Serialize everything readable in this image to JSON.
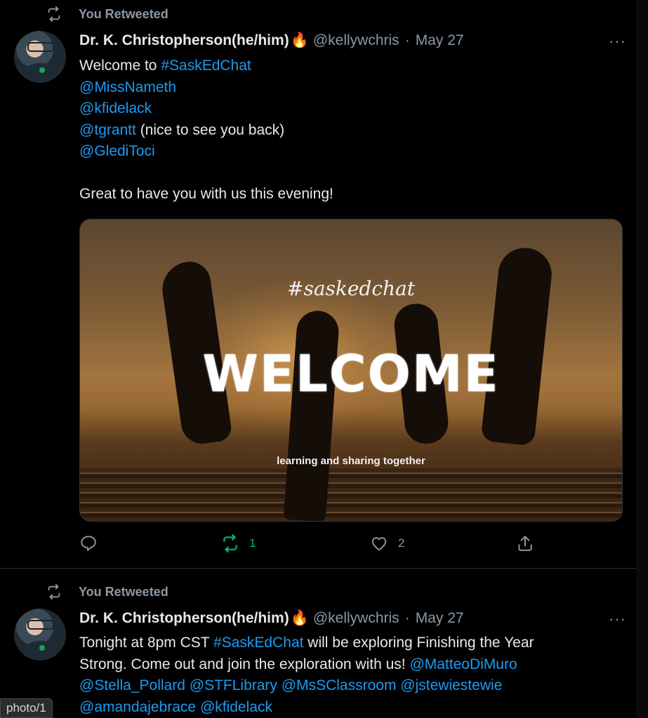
{
  "tweets": [
    {
      "retweet_label": "You Retweeted",
      "name": "Dr. K. Christopherson(he/him)",
      "emoji": "🔥",
      "handle": "@kellywchris",
      "sep": "·",
      "date": "May 27",
      "more": "···",
      "lines": [
        [
          {
            "t": "Welcome to ",
            "c": "text"
          },
          {
            "t": "#SaskEdChat",
            "c": "link"
          }
        ],
        [
          {
            "t": "@MissNameth",
            "c": "link"
          }
        ],
        [
          {
            "t": "@kfidelack",
            "c": "link"
          }
        ],
        [
          {
            "t": "@tgrantt",
            "c": "link"
          },
          {
            "t": " (nice to see you back)",
            "c": "text"
          }
        ],
        [
          {
            "t": "@GlediToci",
            "c": "link"
          }
        ],
        [
          {
            "t": "",
            "c": "text"
          }
        ],
        [
          {
            "t": "Great to have you with us this evening!",
            "c": "text"
          }
        ]
      ],
      "media": {
        "script_tag": "#saskedchat",
        "title": "WELCOME",
        "tagline": "learning and sharing together"
      },
      "actions": {
        "reply": "",
        "retweet": "1",
        "like": "2"
      }
    },
    {
      "retweet_label": "You Retweeted",
      "name": "Dr. K. Christopherson(he/him)",
      "emoji": "🔥",
      "handle": "@kellywchris",
      "sep": "·",
      "date": "May 27",
      "more": "···",
      "lines": [
        [
          {
            "t": "Tonight at 8pm CST ",
            "c": "text"
          },
          {
            "t": "#SaskEdChat",
            "c": "link"
          },
          {
            "t": " will be exploring Finishing the Year",
            "c": "text"
          }
        ],
        [
          {
            "t": "Strong. Come out and join the exploration with us! ",
            "c": "text"
          },
          {
            "t": "@MatteoDiMuro",
            "c": "link"
          }
        ],
        [
          {
            "t": "@Stella_Pollard",
            "c": "link"
          },
          {
            "t": " ",
            "c": "text"
          },
          {
            "t": "@STFLibrary",
            "c": "link"
          },
          {
            "t": " ",
            "c": "text"
          },
          {
            "t": "@MsSClassroom",
            "c": "link"
          },
          {
            "t": " ",
            "c": "text"
          },
          {
            "t": "@jstewiestewie",
            "c": "link"
          }
        ],
        [
          {
            "t": "@amandajebrace",
            "c": "link"
          },
          {
            "t": " ",
            "c": "text"
          },
          {
            "t": "@kfidelack",
            "c": "link"
          }
        ]
      ]
    }
  ],
  "status_bar": {
    "text": "photo/1"
  },
  "icons": [
    "retweet-icon",
    "reply-icon",
    "like-icon",
    "share-icon",
    "more-icon"
  ],
  "colors": {
    "link": "#1d9bf0",
    "retweet_active": "#00ba7c",
    "muted": "#8b98a5",
    "background": "#000000"
  }
}
